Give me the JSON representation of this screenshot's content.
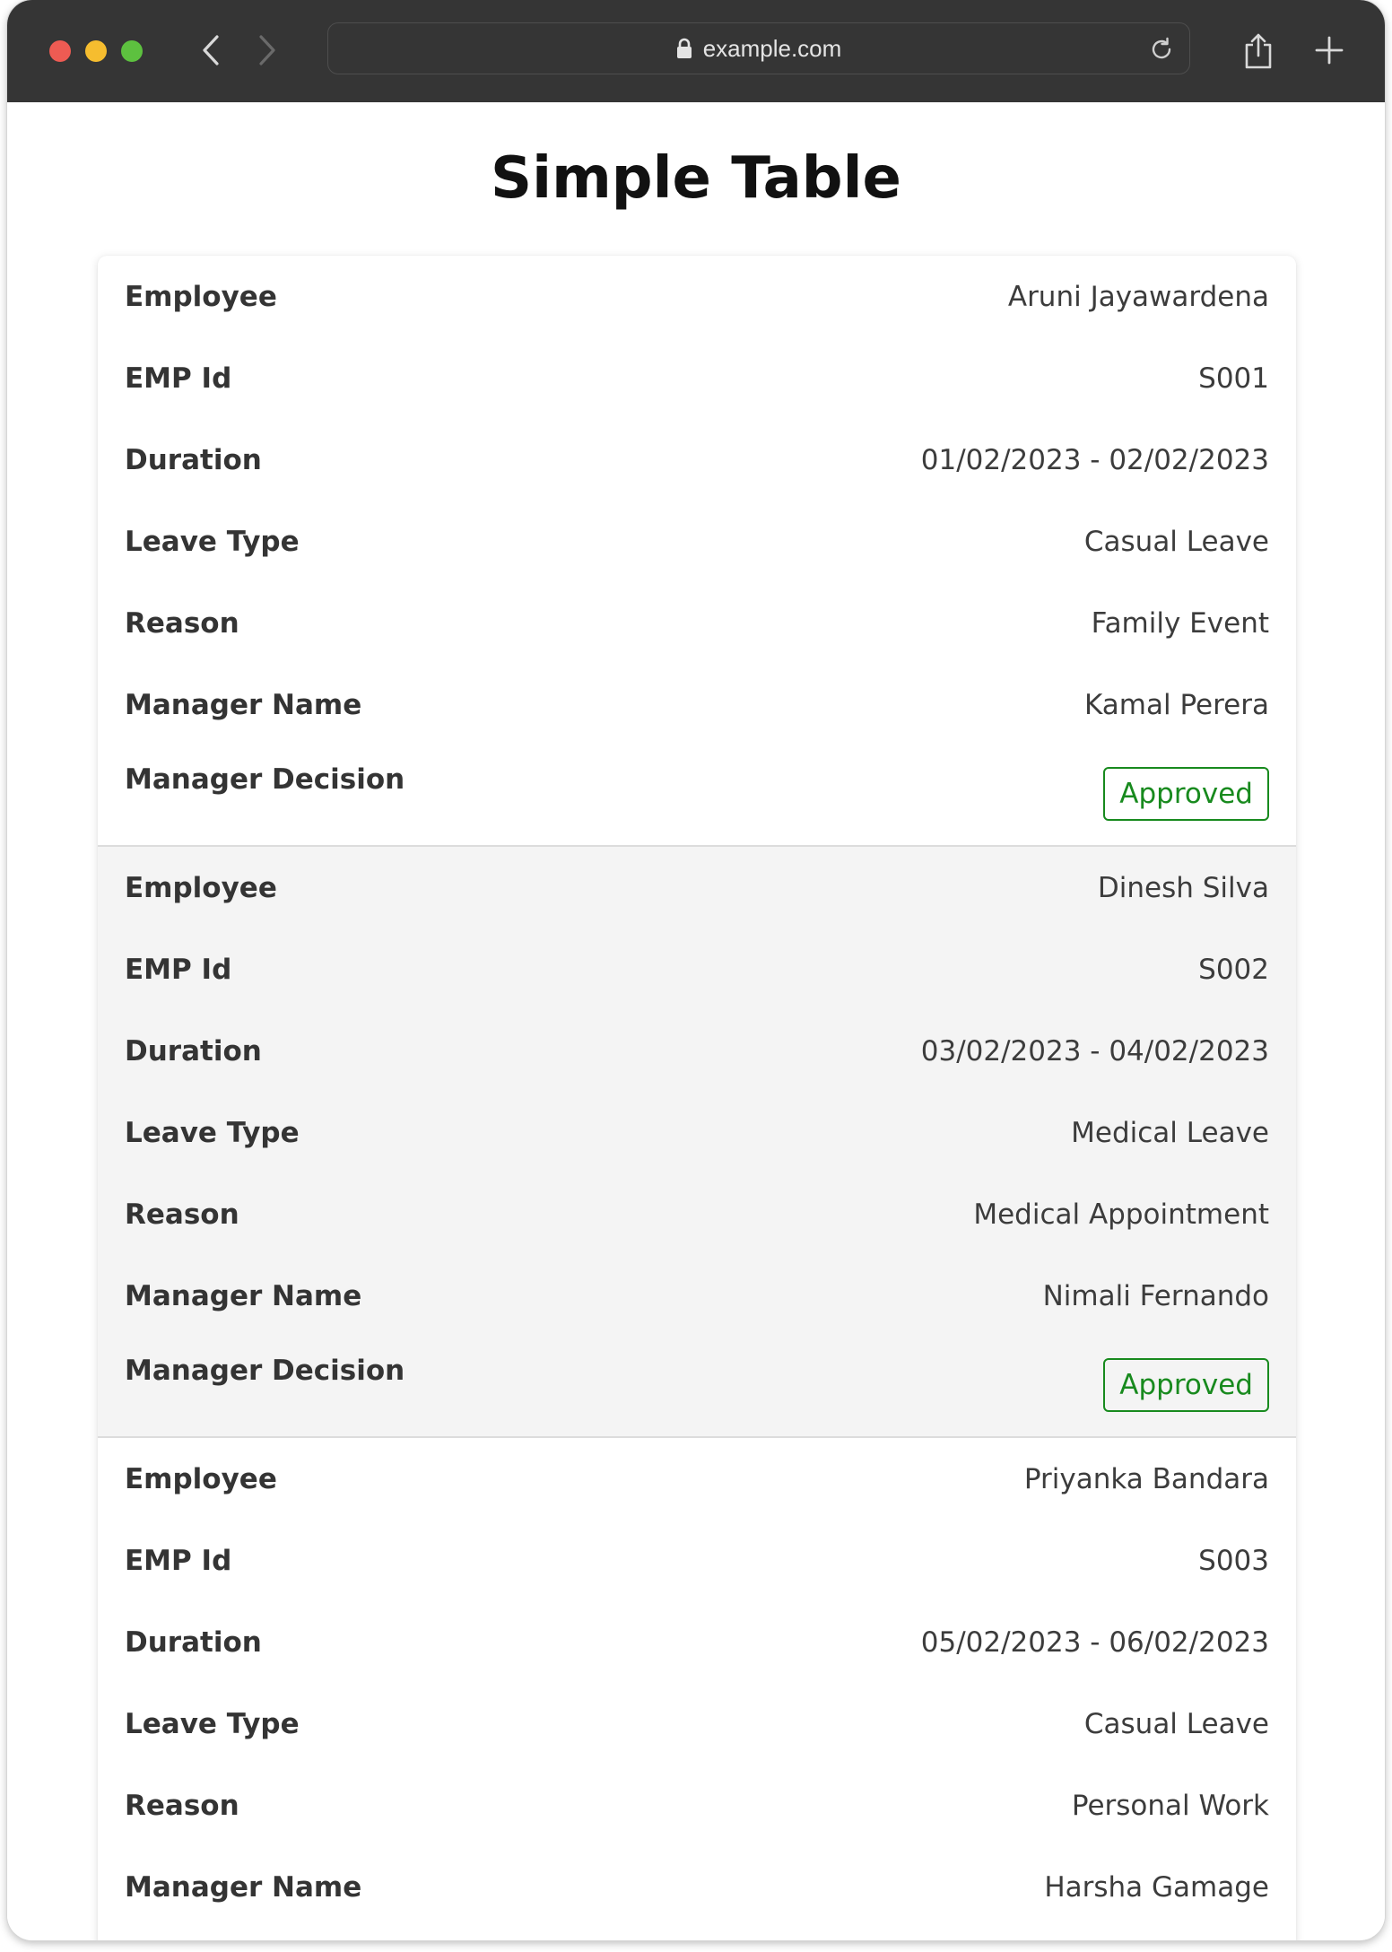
{
  "browser": {
    "url": "example.com"
  },
  "page": {
    "title": "Simple Table"
  },
  "status_colors": {
    "approved": "#188a1e"
  },
  "records": [
    {
      "fields": [
        {
          "label": "Employee",
          "value": "Aruni Jayawardena"
        },
        {
          "label": "EMP Id",
          "value": "S001"
        },
        {
          "label": "Duration",
          "value": "01/02/2023 - 02/02/2023"
        },
        {
          "label": "Leave Type",
          "value": "Casual Leave"
        },
        {
          "label": "Reason",
          "value": "Family Event"
        },
        {
          "label": "Manager Name",
          "value": "Kamal Perera"
        },
        {
          "label": "Manager Decision",
          "value": "Approved"
        }
      ]
    },
    {
      "fields": [
        {
          "label": "Employee",
          "value": "Dinesh Silva"
        },
        {
          "label": "EMP Id",
          "value": "S002"
        },
        {
          "label": "Duration",
          "value": "03/02/2023 - 04/02/2023"
        },
        {
          "label": "Leave Type",
          "value": "Medical Leave"
        },
        {
          "label": "Reason",
          "value": "Medical Appointment"
        },
        {
          "label": "Manager Name",
          "value": "Nimali Fernando"
        },
        {
          "label": "Manager Decision",
          "value": "Approved"
        }
      ]
    },
    {
      "fields": [
        {
          "label": "Employee",
          "value": "Priyanka Bandara"
        },
        {
          "label": "EMP Id",
          "value": "S003"
        },
        {
          "label": "Duration",
          "value": "05/02/2023 - 06/02/2023"
        },
        {
          "label": "Leave Type",
          "value": "Casual Leave"
        },
        {
          "label": "Reason",
          "value": "Personal Work"
        },
        {
          "label": "Manager Name",
          "value": "Harsha Gamage"
        }
      ]
    }
  ]
}
